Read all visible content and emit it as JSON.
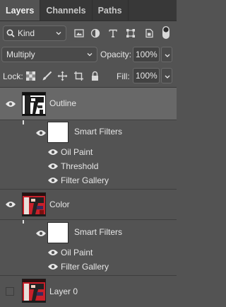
{
  "tabs": [
    {
      "label": "Layers",
      "active": true
    },
    {
      "label": "Channels",
      "active": false
    },
    {
      "label": "Paths",
      "active": false
    }
  ],
  "filter": {
    "kind_label": "Kind"
  },
  "blend": {
    "mode": "Multiply",
    "opacity_label": "Opacity:",
    "opacity_value": "100%"
  },
  "lock": {
    "label": "Lock:",
    "fill_label": "Fill:",
    "fill_value": "100%"
  },
  "layers": [
    {
      "name": "Outline",
      "visible": true,
      "selected": true,
      "smart_filters_label": "Smart Filters",
      "filters": [
        "Oil Paint",
        "Threshold",
        "Filter Gallery"
      ]
    },
    {
      "name": "Color",
      "visible": true,
      "selected": false,
      "smart_filters_label": "Smart Filters",
      "filters": [
        "Oil Paint",
        "Filter Gallery"
      ]
    },
    {
      "name": "Layer 0",
      "visible": false,
      "selected": false
    }
  ],
  "colors": {
    "panel": "#535353",
    "selected_row": "#686868",
    "tabbar": "#383838",
    "thumb_red": "#c8202a"
  }
}
